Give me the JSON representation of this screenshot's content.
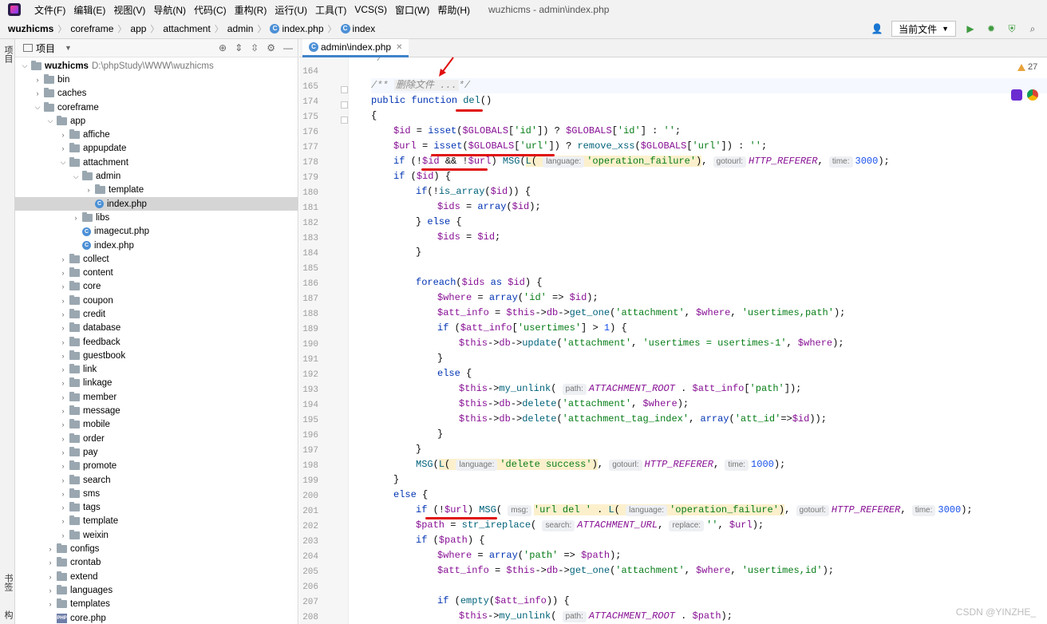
{
  "menubar": {
    "items": [
      "文件(F)",
      "编辑(E)",
      "视图(V)",
      "导航(N)",
      "代码(C)",
      "重构(R)",
      "运行(U)",
      "工具(T)",
      "VCS(S)",
      "窗口(W)",
      "帮助(H)"
    ],
    "window_title": "wuzhicms - admin\\index.php"
  },
  "breadcrumb": [
    "wuzhicms",
    "coreframe",
    "app",
    "attachment",
    "admin",
    "index.php",
    "index"
  ],
  "toolbar": {
    "run_config": "当前文件"
  },
  "side_strip": {
    "project_label": "项目",
    "bookmarks_label": "书签",
    "structure_label": "结构"
  },
  "project_panel": {
    "title": "项目",
    "root_name": "wuzhicms",
    "root_path": "D:\\phpStudy\\WWW\\wuzhicms",
    "tree": [
      {
        "label": "bin",
        "depth": 1,
        "type": "folder",
        "expanded": false
      },
      {
        "label": "caches",
        "depth": 1,
        "type": "folder",
        "expanded": false
      },
      {
        "label": "coreframe",
        "depth": 1,
        "type": "folder",
        "expanded": true
      },
      {
        "label": "app",
        "depth": 2,
        "type": "folder",
        "expanded": true
      },
      {
        "label": "affiche",
        "depth": 3,
        "type": "folder",
        "expanded": false
      },
      {
        "label": "appupdate",
        "depth": 3,
        "type": "folder",
        "expanded": false
      },
      {
        "label": "attachment",
        "depth": 3,
        "type": "folder",
        "expanded": true
      },
      {
        "label": "admin",
        "depth": 4,
        "type": "folder",
        "expanded": true
      },
      {
        "label": "template",
        "depth": 5,
        "type": "folder",
        "expanded": false
      },
      {
        "label": "index.php",
        "depth": 5,
        "type": "php",
        "selected": true
      },
      {
        "label": "libs",
        "depth": 4,
        "type": "folder",
        "expanded": false
      },
      {
        "label": "imagecut.php",
        "depth": 4,
        "type": "php"
      },
      {
        "label": "index.php",
        "depth": 4,
        "type": "php"
      },
      {
        "label": "collect",
        "depth": 3,
        "type": "folder",
        "expanded": false
      },
      {
        "label": "content",
        "depth": 3,
        "type": "folder",
        "expanded": false
      },
      {
        "label": "core",
        "depth": 3,
        "type": "folder",
        "expanded": false
      },
      {
        "label": "coupon",
        "depth": 3,
        "type": "folder",
        "expanded": false
      },
      {
        "label": "credit",
        "depth": 3,
        "type": "folder",
        "expanded": false
      },
      {
        "label": "database",
        "depth": 3,
        "type": "folder",
        "expanded": false
      },
      {
        "label": "feedback",
        "depth": 3,
        "type": "folder",
        "expanded": false
      },
      {
        "label": "guestbook",
        "depth": 3,
        "type": "folder",
        "expanded": false
      },
      {
        "label": "link",
        "depth": 3,
        "type": "folder",
        "expanded": false
      },
      {
        "label": "linkage",
        "depth": 3,
        "type": "folder",
        "expanded": false
      },
      {
        "label": "member",
        "depth": 3,
        "type": "folder",
        "expanded": false
      },
      {
        "label": "message",
        "depth": 3,
        "type": "folder",
        "expanded": false
      },
      {
        "label": "mobile",
        "depth": 3,
        "type": "folder",
        "expanded": false
      },
      {
        "label": "order",
        "depth": 3,
        "type": "folder",
        "expanded": false
      },
      {
        "label": "pay",
        "depth": 3,
        "type": "folder",
        "expanded": false
      },
      {
        "label": "promote",
        "depth": 3,
        "type": "folder",
        "expanded": false
      },
      {
        "label": "search",
        "depth": 3,
        "type": "folder",
        "expanded": false
      },
      {
        "label": "sms",
        "depth": 3,
        "type": "folder",
        "expanded": false
      },
      {
        "label": "tags",
        "depth": 3,
        "type": "folder",
        "expanded": false
      },
      {
        "label": "template",
        "depth": 3,
        "type": "folder",
        "expanded": false
      },
      {
        "label": "weixin",
        "depth": 3,
        "type": "folder",
        "expanded": false
      },
      {
        "label": "configs",
        "depth": 2,
        "type": "folder",
        "expanded": false
      },
      {
        "label": "crontab",
        "depth": 2,
        "type": "folder",
        "expanded": false
      },
      {
        "label": "extend",
        "depth": 2,
        "type": "folder",
        "expanded": false
      },
      {
        "label": "languages",
        "depth": 2,
        "type": "folder",
        "expanded": false
      },
      {
        "label": "templates",
        "depth": 2,
        "type": "folder",
        "expanded": false
      },
      {
        "label": "core.php",
        "depth": 2,
        "type": "phpplain"
      }
    ]
  },
  "editor": {
    "tab_label": "admin\\index.php",
    "warning_count": "27",
    "line_numbers": [
      "164",
      "165",
      "174",
      "175",
      "176",
      "177",
      "178",
      "179",
      "180",
      "181",
      "182",
      "183",
      "184",
      "185",
      "186",
      "187",
      "188",
      "189",
      "190",
      "191",
      "192",
      "193",
      "194",
      "195",
      "196",
      "197",
      "198",
      "199",
      "200",
      "201",
      "202",
      "203",
      "204",
      "205",
      "206",
      "207",
      "208"
    ]
  },
  "watermark": "CSDN @YINZHE_"
}
